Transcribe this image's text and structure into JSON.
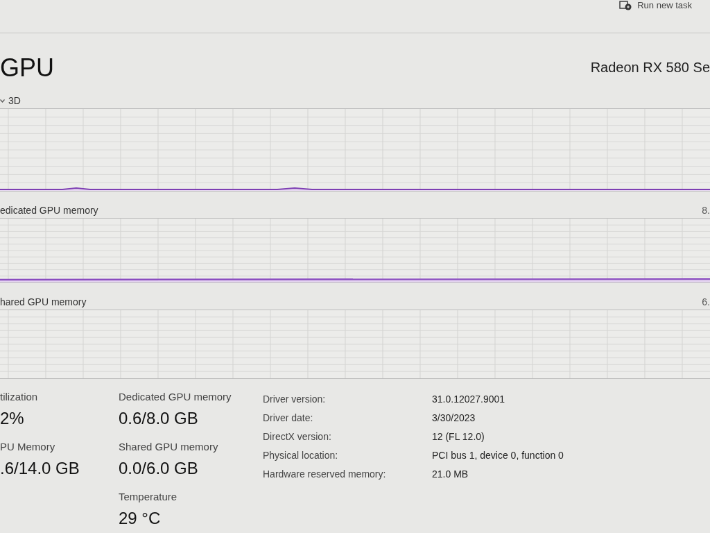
{
  "toolbar": {
    "run_new_task": "Run new task"
  },
  "header": {
    "title": "GPU",
    "device_name": "Radeon RX 580 Se"
  },
  "graphs": [
    {
      "kind": "engine",
      "label": "3D"
    },
    {
      "kind": "memory",
      "label": "edicated GPU memory",
      "max": "8."
    },
    {
      "kind": "memory",
      "label": "hared GPU memory",
      "max": "6."
    }
  ],
  "stat_columns": [
    [
      {
        "label": "tilization",
        "value": "2%"
      },
      {
        "label": "PU Memory",
        "value": ".6/14.0 GB"
      }
    ],
    [
      {
        "label": "Dedicated GPU memory",
        "value": "0.6/8.0 GB"
      },
      {
        "label": "Shared GPU memory",
        "value": "0.0/6.0 GB"
      },
      {
        "label": "Temperature",
        "value": "29 °C"
      }
    ]
  ],
  "details": [
    {
      "label": "Driver version:",
      "value": "31.0.12027.9001"
    },
    {
      "label": "Driver date:",
      "value": "3/30/2023"
    },
    {
      "label": "DirectX version:",
      "value": "12 (FL 12.0)"
    },
    {
      "label": "Physical location:",
      "value": "PCI bus 1, device 0, function 0"
    },
    {
      "label": "Hardware reserved memory:",
      "value": "21.0 MB"
    }
  ]
}
